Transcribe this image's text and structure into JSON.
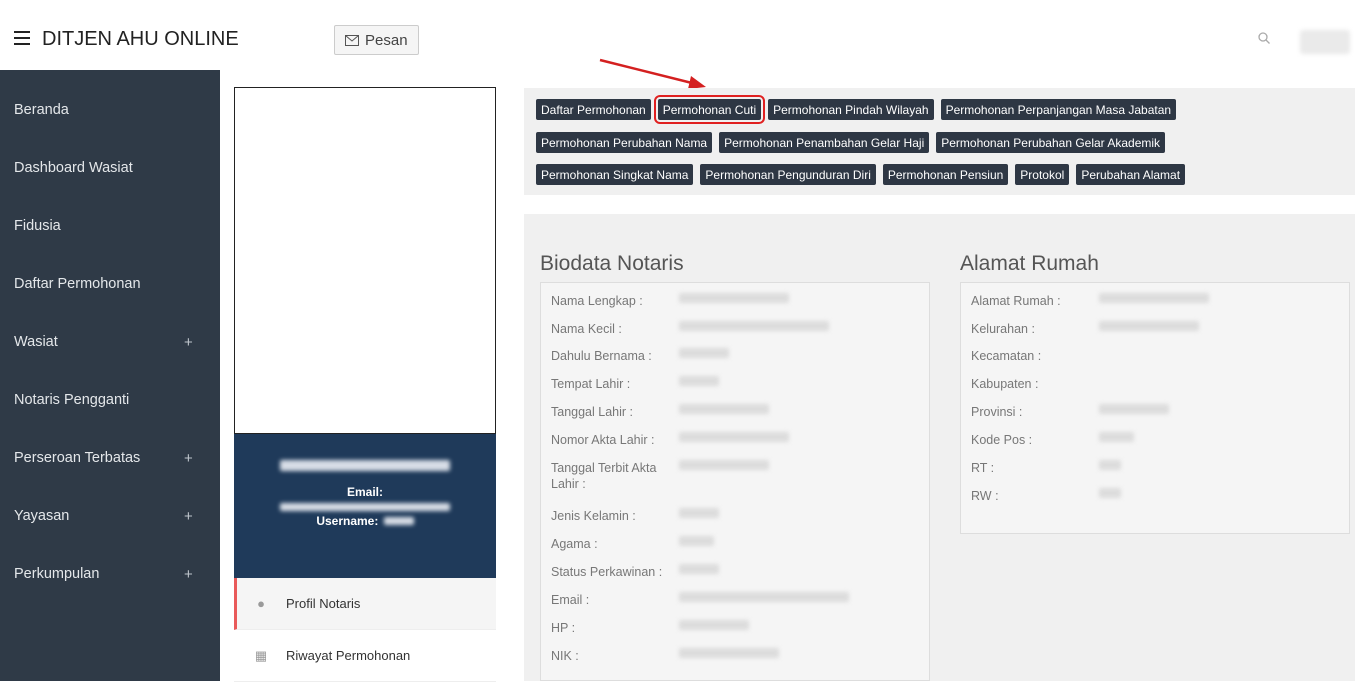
{
  "header": {
    "brand": "DITJEN AHU ONLINE",
    "pesan_label": "Pesan",
    "menu_icon": "hamburger-icon",
    "search_icon": "search-icon"
  },
  "sidebar": {
    "items": [
      {
        "label": "Beranda",
        "expandable": false
      },
      {
        "label": "Dashboard Wasiat",
        "expandable": false
      },
      {
        "label": "Fidusia",
        "expandable": false
      },
      {
        "label": "Daftar Permohonan",
        "expandable": false
      },
      {
        "label": "Wasiat",
        "expandable": true
      },
      {
        "label": "Notaris Pengganti",
        "expandable": false
      },
      {
        "label": "Perseroan Terbatas",
        "expandable": true
      },
      {
        "label": "Yayasan",
        "expandable": true
      },
      {
        "label": "Perkumpulan",
        "expandable": true
      }
    ],
    "plus": "+"
  },
  "profile": {
    "email_label": "Email:",
    "username_label": "Username:",
    "menu": [
      {
        "label": "Profil Notaris",
        "icon": "user-icon",
        "active": true
      },
      {
        "label": "Riwayat Permohonan",
        "icon": "calendar-icon",
        "active": false
      }
    ]
  },
  "actions": {
    "row1": [
      "Daftar Permohonan",
      "Permohonan Cuti",
      "Permohonan Pindah Wilayah",
      "Permohonan Perpanjangan Masa Jabatan"
    ],
    "row2": [
      "Permohonan Perubahan Nama",
      "Permohonan Penambahan Gelar Haji",
      "Permohonan Perubahan Gelar Akademik"
    ],
    "row3": [
      "Permohonan Singkat Nama",
      "Permohonan Pengunduran Diri",
      "Permohonan Pensiun",
      "Protokol",
      "Perubahan Alamat"
    ],
    "highlighted": "Permohonan Cuti"
  },
  "biodata": {
    "title": "Biodata Notaris",
    "fields": [
      "Nama Lengkap :",
      "Nama Kecil :",
      "Dahulu Bernama :",
      "Tempat Lahir :",
      "Tanggal Lahir :",
      "Nomor Akta Lahir :",
      "Tanggal Terbit Akta Lahir :",
      "Jenis Kelamin :",
      "Agama :",
      "Status Perkawinan :",
      "Email :",
      "HP :",
      "NIK :"
    ]
  },
  "alamat": {
    "title": "Alamat Rumah",
    "fields": [
      "Alamat Rumah :",
      "Kelurahan :",
      "Kecamatan :",
      "Kabupaten :",
      "Provinsi :",
      "Kode Pos :",
      "RT :",
      "RW :"
    ]
  },
  "colors": {
    "sidebar_bg": "#2f3a47",
    "button_bg": "#2e3744",
    "highlight": "#e02020",
    "profile_card_bg": "#1f3a5a",
    "active_accent": "#e95a5a"
  }
}
